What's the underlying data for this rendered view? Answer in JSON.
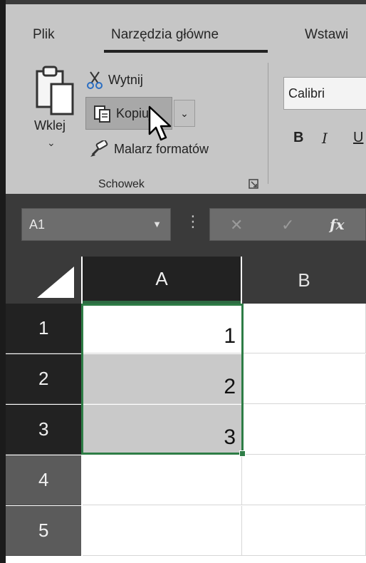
{
  "ribbon": {
    "tabs": [
      "Plik",
      "Narzędzia główne",
      "Wstawi"
    ],
    "clipboard": {
      "paste_label": "Wklej",
      "cut_label": "Wytnij",
      "copy_label": "Kopiuj",
      "painter_label": "Malarz formatów",
      "group_label": "Schowek"
    },
    "font": {
      "name": "Calibri",
      "bold": "B",
      "italic": "I",
      "underline": "U"
    }
  },
  "formula_bar": {
    "name_box": "A1",
    "dots": "⋮",
    "cancel": "✕",
    "enter": "✓",
    "fx": "fx"
  },
  "grid": {
    "columns": [
      "A",
      "B"
    ],
    "rows": [
      "1",
      "2",
      "3",
      "4",
      "5"
    ],
    "cells_a": [
      "1",
      "2",
      "3",
      "",
      ""
    ]
  },
  "colors": {
    "accent_green": "#2e7d46"
  }
}
